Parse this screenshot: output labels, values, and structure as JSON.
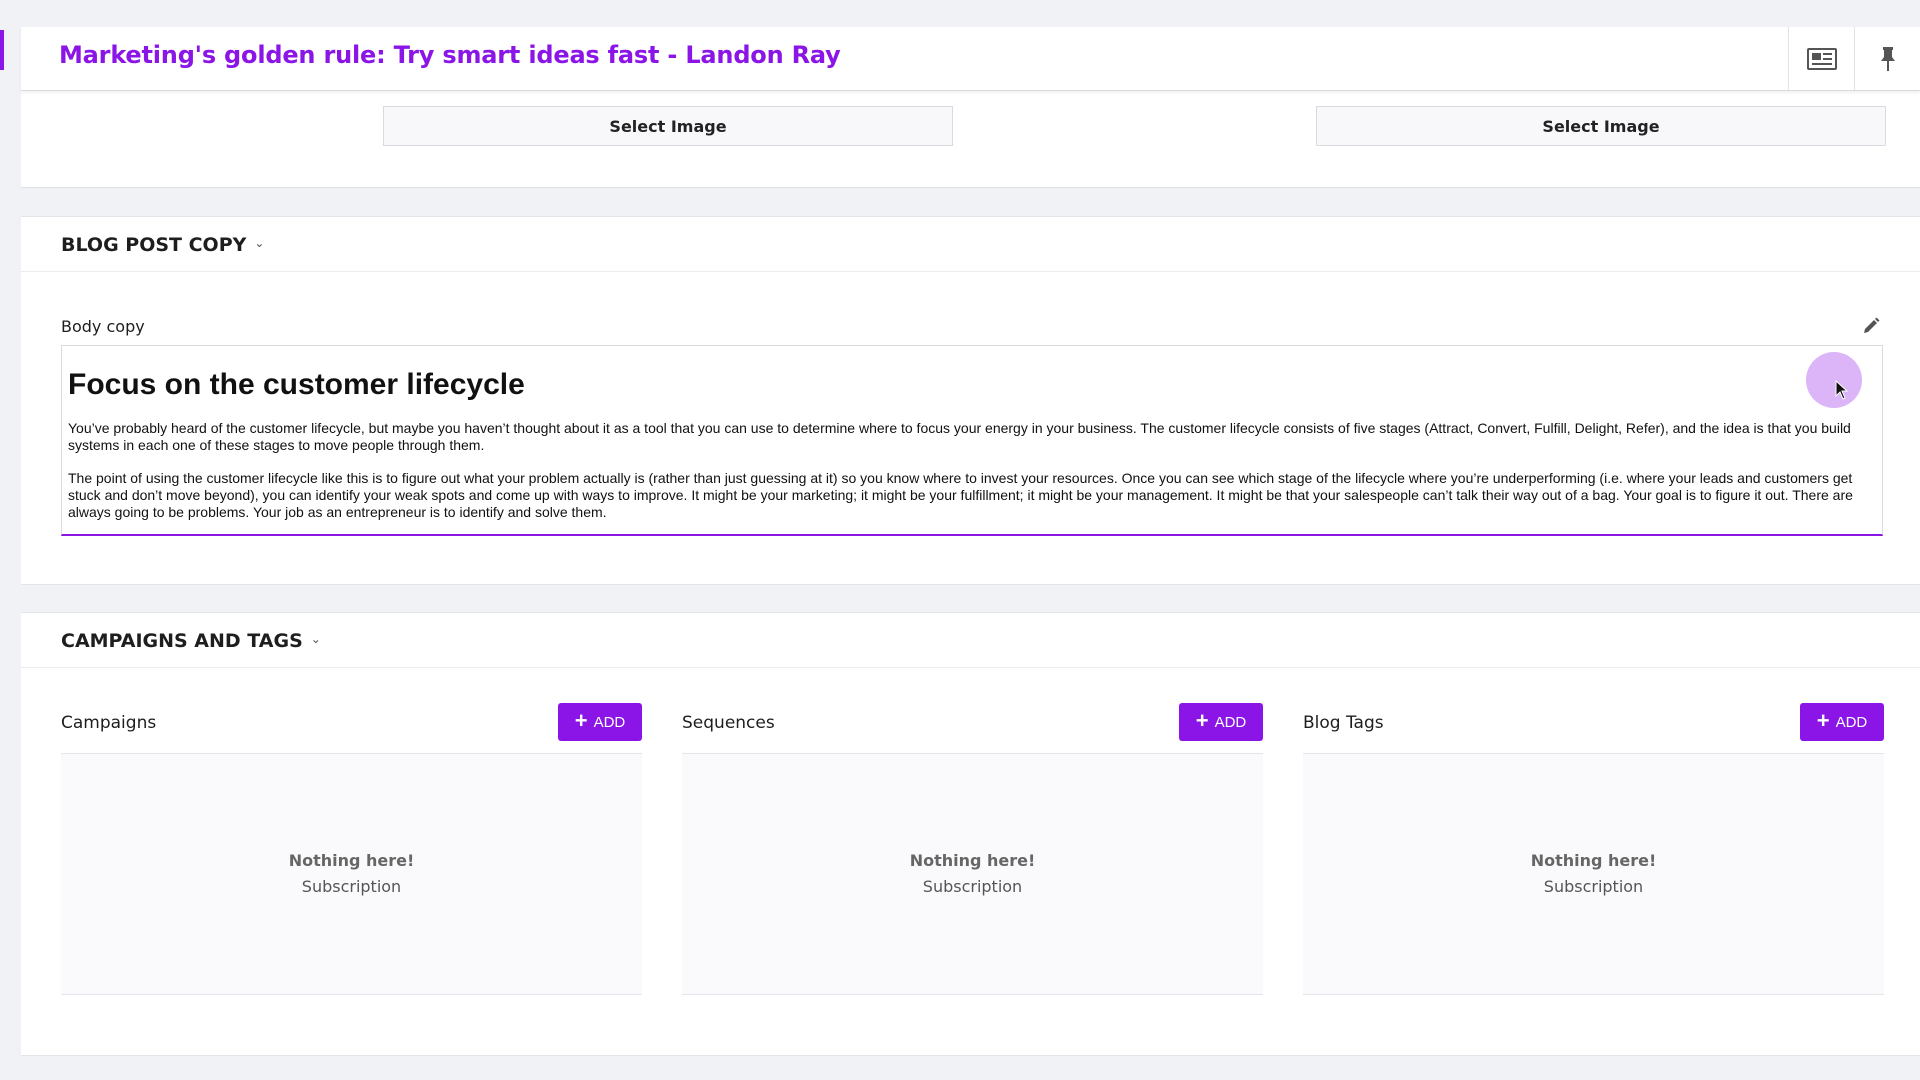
{
  "header": {
    "title": "Marketing's golden rule: Try smart ideas fast - Landon Ray",
    "icons": [
      "newspaper-icon",
      "pin-icon"
    ]
  },
  "image_panel": {
    "select_image_1": "Select Image",
    "select_image_2": "Select Image"
  },
  "blog_copy": {
    "section_title": "BLOG POST COPY",
    "body_label": "Body copy",
    "heading": "Focus on the customer lifecycle",
    "paragraph_1": "You’ve probably heard of the customer lifecycle, but maybe you haven’t thought about it as a tool that you can use to determine where to focus your energy in your business. The customer lifecycle consists of five stages (Attract, Convert, Fulfill, Delight, Refer), and the idea is that you build systems in each one of these stages to move people through them.",
    "paragraph_2": "The point of using the customer lifecycle like this is to figure out what your problem actually is (rather than just guessing at it) so you know where to invest your resources. Once you can see which stage of the lifecycle where you’re underperforming (i.e. where your leads and customers get stuck and don’t move beyond), you can identify your weak spots and come up with ways to improve. It might be your marketing; it might be your fulfillment; it might be your management. It might be that your salespeople can’t talk their way out of a bag. Your goal is to figure it out. There are always going to be problems. Your job as an entrepreneur is to identify and solve them."
  },
  "campaigns_tags": {
    "section_title": "CAMPAIGNS AND TAGS",
    "columns": [
      {
        "label": "Campaigns",
        "add_label": "ADD",
        "empty_title": "Nothing here!",
        "empty_sub": "Subscription"
      },
      {
        "label": "Sequences",
        "add_label": "ADD",
        "empty_title": "Nothing here!",
        "empty_sub": "Subscription"
      },
      {
        "label": "Blog Tags",
        "add_label": "ADD",
        "empty_title": "Nothing here!",
        "empty_sub": "Subscription"
      }
    ]
  },
  "colors": {
    "accent": "#8a15e6",
    "background": "#f1f2f5"
  }
}
